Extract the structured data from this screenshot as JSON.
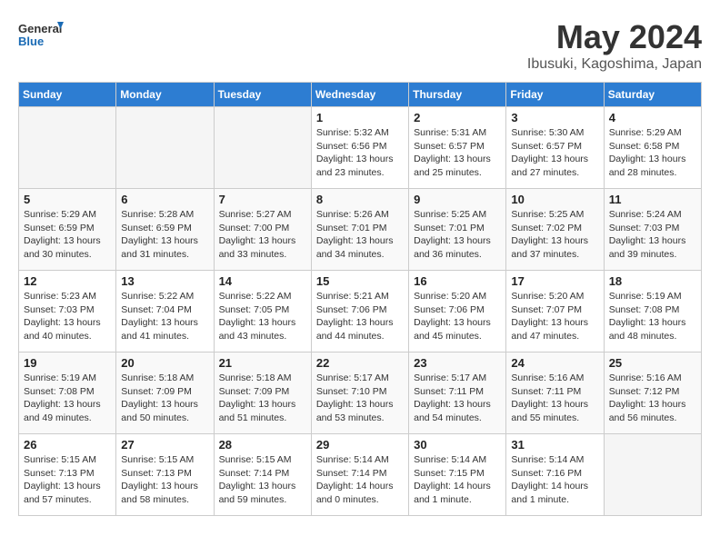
{
  "logo": {
    "line1": "General",
    "line2": "Blue"
  },
  "title": "May 2024",
  "subtitle": "Ibusuki, Kagoshima, Japan",
  "headers": [
    "Sunday",
    "Monday",
    "Tuesday",
    "Wednesday",
    "Thursday",
    "Friday",
    "Saturday"
  ],
  "weeks": [
    [
      {
        "num": "",
        "info": ""
      },
      {
        "num": "",
        "info": ""
      },
      {
        "num": "",
        "info": ""
      },
      {
        "num": "1",
        "info": "Sunrise: 5:32 AM\nSunset: 6:56 PM\nDaylight: 13 hours\nand 23 minutes."
      },
      {
        "num": "2",
        "info": "Sunrise: 5:31 AM\nSunset: 6:57 PM\nDaylight: 13 hours\nand 25 minutes."
      },
      {
        "num": "3",
        "info": "Sunrise: 5:30 AM\nSunset: 6:57 PM\nDaylight: 13 hours\nand 27 minutes."
      },
      {
        "num": "4",
        "info": "Sunrise: 5:29 AM\nSunset: 6:58 PM\nDaylight: 13 hours\nand 28 minutes."
      }
    ],
    [
      {
        "num": "5",
        "info": "Sunrise: 5:29 AM\nSunset: 6:59 PM\nDaylight: 13 hours\nand 30 minutes."
      },
      {
        "num": "6",
        "info": "Sunrise: 5:28 AM\nSunset: 6:59 PM\nDaylight: 13 hours\nand 31 minutes."
      },
      {
        "num": "7",
        "info": "Sunrise: 5:27 AM\nSunset: 7:00 PM\nDaylight: 13 hours\nand 33 minutes."
      },
      {
        "num": "8",
        "info": "Sunrise: 5:26 AM\nSunset: 7:01 PM\nDaylight: 13 hours\nand 34 minutes."
      },
      {
        "num": "9",
        "info": "Sunrise: 5:25 AM\nSunset: 7:01 PM\nDaylight: 13 hours\nand 36 minutes."
      },
      {
        "num": "10",
        "info": "Sunrise: 5:25 AM\nSunset: 7:02 PM\nDaylight: 13 hours\nand 37 minutes."
      },
      {
        "num": "11",
        "info": "Sunrise: 5:24 AM\nSunset: 7:03 PM\nDaylight: 13 hours\nand 39 minutes."
      }
    ],
    [
      {
        "num": "12",
        "info": "Sunrise: 5:23 AM\nSunset: 7:03 PM\nDaylight: 13 hours\nand 40 minutes."
      },
      {
        "num": "13",
        "info": "Sunrise: 5:22 AM\nSunset: 7:04 PM\nDaylight: 13 hours\nand 41 minutes."
      },
      {
        "num": "14",
        "info": "Sunrise: 5:22 AM\nSunset: 7:05 PM\nDaylight: 13 hours\nand 43 minutes."
      },
      {
        "num": "15",
        "info": "Sunrise: 5:21 AM\nSunset: 7:06 PM\nDaylight: 13 hours\nand 44 minutes."
      },
      {
        "num": "16",
        "info": "Sunrise: 5:20 AM\nSunset: 7:06 PM\nDaylight: 13 hours\nand 45 minutes."
      },
      {
        "num": "17",
        "info": "Sunrise: 5:20 AM\nSunset: 7:07 PM\nDaylight: 13 hours\nand 47 minutes."
      },
      {
        "num": "18",
        "info": "Sunrise: 5:19 AM\nSunset: 7:08 PM\nDaylight: 13 hours\nand 48 minutes."
      }
    ],
    [
      {
        "num": "19",
        "info": "Sunrise: 5:19 AM\nSunset: 7:08 PM\nDaylight: 13 hours\nand 49 minutes."
      },
      {
        "num": "20",
        "info": "Sunrise: 5:18 AM\nSunset: 7:09 PM\nDaylight: 13 hours\nand 50 minutes."
      },
      {
        "num": "21",
        "info": "Sunrise: 5:18 AM\nSunset: 7:09 PM\nDaylight: 13 hours\nand 51 minutes."
      },
      {
        "num": "22",
        "info": "Sunrise: 5:17 AM\nSunset: 7:10 PM\nDaylight: 13 hours\nand 53 minutes."
      },
      {
        "num": "23",
        "info": "Sunrise: 5:17 AM\nSunset: 7:11 PM\nDaylight: 13 hours\nand 54 minutes."
      },
      {
        "num": "24",
        "info": "Sunrise: 5:16 AM\nSunset: 7:11 PM\nDaylight: 13 hours\nand 55 minutes."
      },
      {
        "num": "25",
        "info": "Sunrise: 5:16 AM\nSunset: 7:12 PM\nDaylight: 13 hours\nand 56 minutes."
      }
    ],
    [
      {
        "num": "26",
        "info": "Sunrise: 5:15 AM\nSunset: 7:13 PM\nDaylight: 13 hours\nand 57 minutes."
      },
      {
        "num": "27",
        "info": "Sunrise: 5:15 AM\nSunset: 7:13 PM\nDaylight: 13 hours\nand 58 minutes."
      },
      {
        "num": "28",
        "info": "Sunrise: 5:15 AM\nSunset: 7:14 PM\nDaylight: 13 hours\nand 59 minutes."
      },
      {
        "num": "29",
        "info": "Sunrise: 5:14 AM\nSunset: 7:14 PM\nDaylight: 14 hours\nand 0 minutes."
      },
      {
        "num": "30",
        "info": "Sunrise: 5:14 AM\nSunset: 7:15 PM\nDaylight: 14 hours\nand 1 minute."
      },
      {
        "num": "31",
        "info": "Sunrise: 5:14 AM\nSunset: 7:16 PM\nDaylight: 14 hours\nand 1 minute."
      },
      {
        "num": "",
        "info": ""
      }
    ]
  ]
}
